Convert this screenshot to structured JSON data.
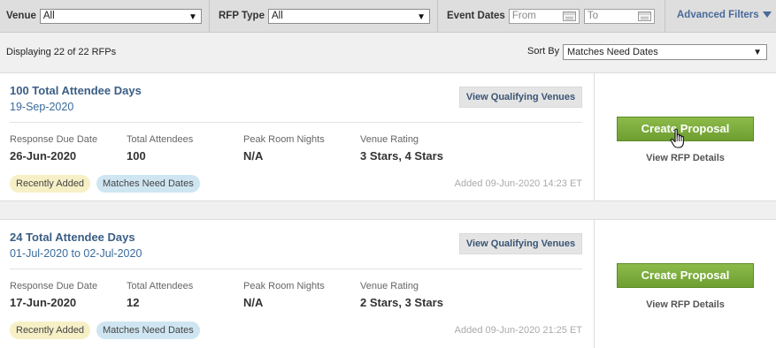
{
  "filters": {
    "venue_label": "Venue",
    "venue_value": "All",
    "rfp_type_label": "RFP Type",
    "rfp_type_value": "All",
    "event_dates_label": "Event Dates",
    "from_placeholder": "From",
    "to_placeholder": "To",
    "advanced_label": "Advanced Filters"
  },
  "results": {
    "displaying": "Displaying 22 of 22 RFPs",
    "sort_label": "Sort By",
    "sort_value": "Matches Need Dates"
  },
  "labels": {
    "view_qualifying": "View Qualifying Venues",
    "create_proposal": "Create Proposal",
    "view_details": "View RFP Details",
    "response_due": "Response Due Date",
    "total_attendees": "Total Attendees",
    "peak_room_nights": "Peak Room Nights",
    "venue_rating": "Venue Rating",
    "recently_added": "Recently Added",
    "matches_need_dates": "Matches Need Dates"
  },
  "rfps": [
    {
      "title": "100 Total Attendee Days",
      "dates": "19-Sep-2020",
      "response_due": "26-Jun-2020",
      "total_attendees": "100",
      "peak_room_nights": "N/A",
      "venue_rating": "3 Stars, 4 Stars",
      "added": "Added 09-Jun-2020 14:23 ET"
    },
    {
      "title": "24 Total Attendee Days",
      "dates": "01-Jul-2020 to 02-Jul-2020",
      "response_due": "17-Jun-2020",
      "total_attendees": "12",
      "peak_room_nights": "N/A",
      "venue_rating": "2 Stars, 3 Stars",
      "added": "Added 09-Jun-2020 21:25 ET"
    }
  ],
  "colors": {
    "accent_blue": "#3a5e85",
    "create_green": "#7aac3c",
    "badge_recent": "#f7f0c6",
    "badge_dates": "#cfe6f2"
  }
}
